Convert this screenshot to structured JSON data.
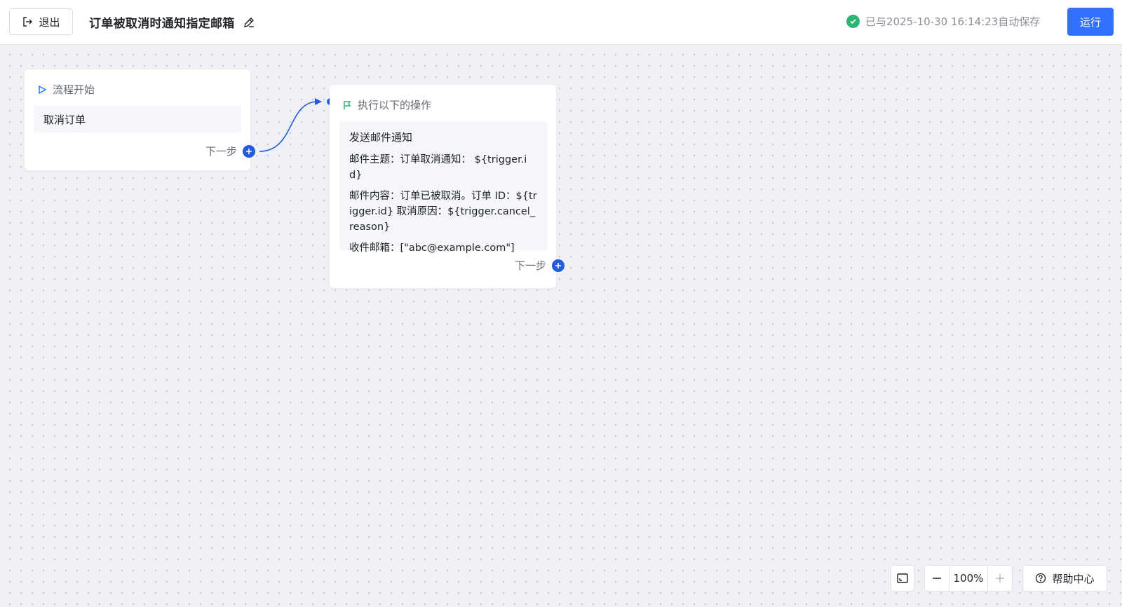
{
  "header": {
    "exit_label": "退出",
    "title": "订单被取消时通知指定邮箱",
    "save_status": "已与2025-10-30 16:14:23自动保存",
    "run_label": "运行"
  },
  "start_node": {
    "header": "流程开始",
    "trigger": "取消订单",
    "next_label": "下一步"
  },
  "action_node": {
    "header": "执行以下的操作",
    "action_title": "发送邮件通知",
    "subject": "邮件主题：订单取消通知： ${trigger.id}",
    "content": "邮件内容：订单已被取消。订单 ID：${trigger.id} 取消原因：${trigger.cancel_reason}",
    "recipients": "收件邮箱：[\"abc@example.com\"]",
    "next_label": "下一步"
  },
  "toolbar": {
    "zoom_value": "100%",
    "help_label": "帮助中心"
  },
  "colors": {
    "primary": "#3370ff",
    "connector": "#245bdb",
    "success": "#2bb673",
    "canvas_bg": "#eef0f6"
  },
  "icons": {
    "exit": "exit-icon",
    "edit": "pencil-icon",
    "saved": "check-circle-icon",
    "start": "play-triangle-icon",
    "action": "flag-icon",
    "add": "plus-circle-icon",
    "fit": "fit-view-icon",
    "zoom_out": "minus-icon",
    "zoom_in": "plus-icon",
    "help": "help-circle-icon"
  }
}
